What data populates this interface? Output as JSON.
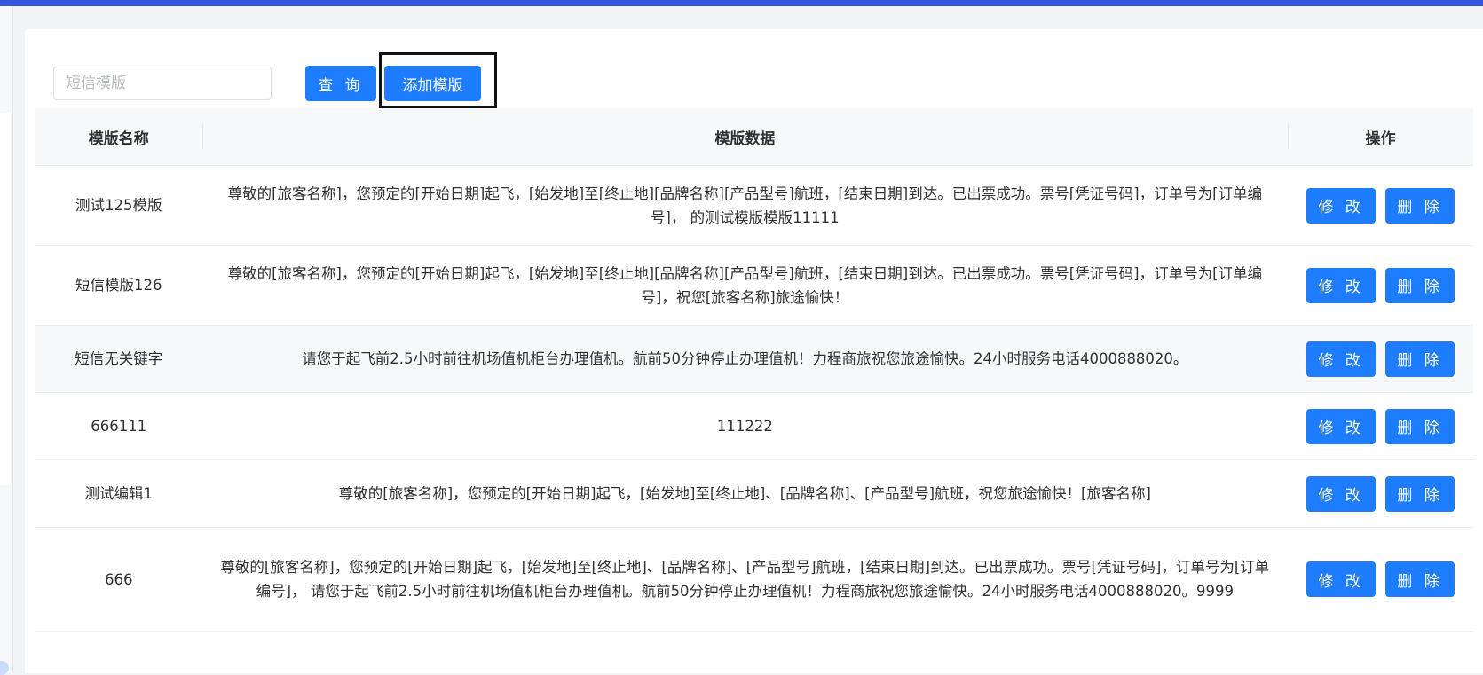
{
  "search": {
    "placeholder": "短信模版",
    "query_label": "查 询",
    "add_label": "添加模版"
  },
  "table": {
    "headers": {
      "name": "模版名称",
      "data": "模版数据",
      "actions": "操作"
    },
    "rows": [
      {
        "name": "测试125模版",
        "data": "尊敬的[旅客名称]，您预定的[开始日期]起飞，[始发地]至[终止地][品牌名称][产品型号]航班，[结束日期]到达。已出票成功。票号[凭证号码]，订单号为[订单编号]， 的测试模版模版11111"
      },
      {
        "name": "短信模版126",
        "data": "尊敬的[旅客名称]，您预定的[开始日期]起飞，[始发地]至[终止地][品牌名称][产品型号]航班，[结束日期]到达。已出票成功。票号[凭证号码]，订单号为[订单编号]，祝您[旅客名称]旅途愉快！"
      },
      {
        "name": "短信无关键字",
        "data": "请您于起飞前2.5小时前往机场值机柜台办理值机。航前50分钟停止办理值机！力程商旅祝您旅途愉快。24小时服务电话4000888020。"
      },
      {
        "name": "666111",
        "data": "111222"
      },
      {
        "name": "测试编辑1",
        "data": "尊敬的[旅客名称]，您预定的[开始日期]起飞，[始发地]至[终止地]、[品牌名称]、[产品型号]航班，祝您旅途愉快！[旅客名称]"
      },
      {
        "name": "666",
        "data": "尊敬的[旅客名称]，您预定的[开始日期]起飞，[始发地]至[终止地]、[品牌名称]、[产品型号]航班，[结束日期]到达。已出票成功。票号[凭证号码]，订单号为[订单编号]， 请您于起飞前2.5小时前往机场值机柜台办理值机。航前50分钟停止办理值机！力程商旅祝您旅途愉快。24小时服务电话4000888020。9999"
      }
    ],
    "edit_label": "修 改",
    "delete_label": "删 除"
  },
  "colors": {
    "primary": "#1e7cff",
    "top_bar": "#3355e0",
    "header_bg": "#f7f8fa"
  }
}
